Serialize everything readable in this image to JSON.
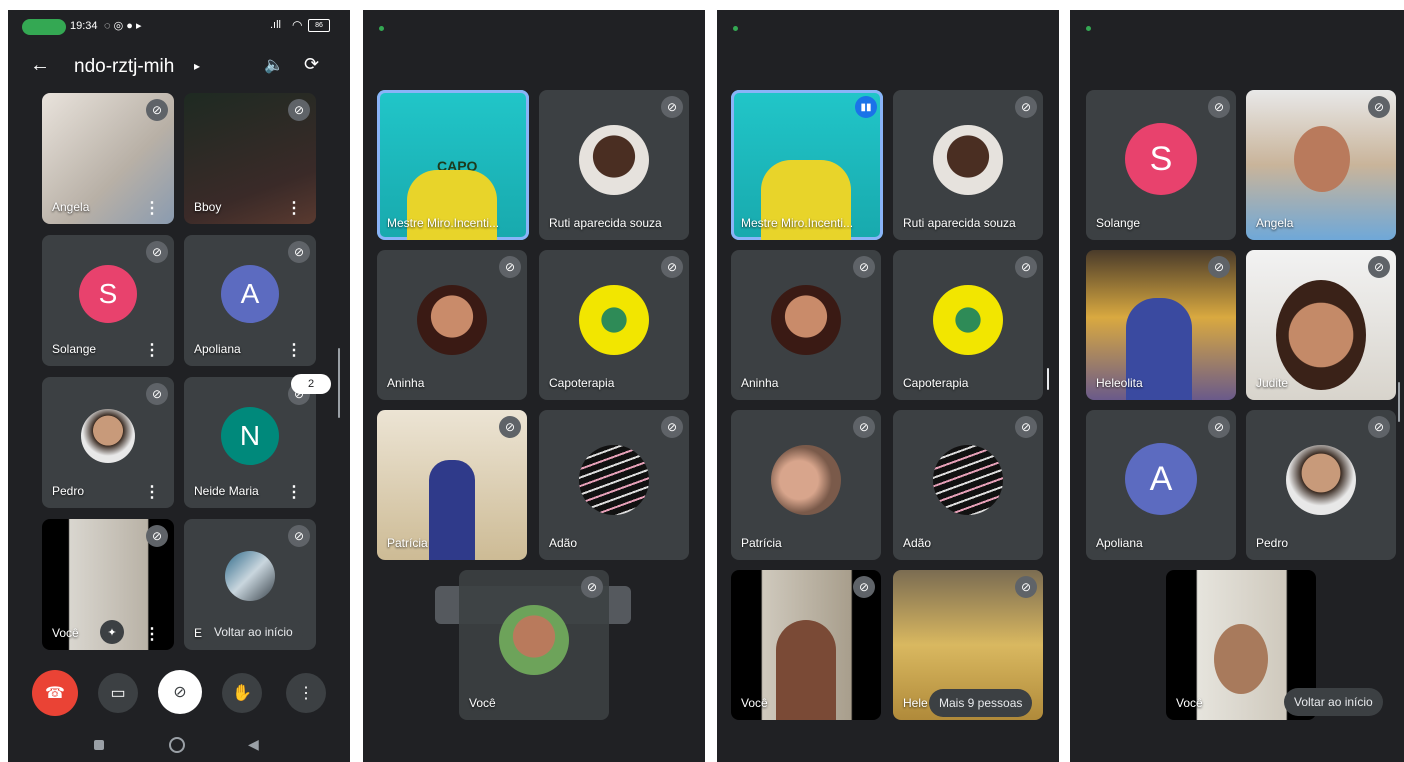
{
  "status_bar": {
    "time": "19:34",
    "signal": ".ıll",
    "battery": "86"
  },
  "call_header": {
    "code": "ndo-rztj-mih",
    "caret": "▸"
  },
  "panel1": {
    "tiles": [
      "Angela",
      "Bboy",
      "Solange",
      "Apoliana",
      "Pedro",
      "Neide Maria",
      "Você",
      "E"
    ],
    "avatar_letters": {
      "solange": "S",
      "apoliana": "A",
      "neide": "N"
    },
    "page_badge": "2",
    "return_button": "Voltar ao início"
  },
  "panel2": {
    "tiles": [
      "Mestre Miro.Incenti...",
      "Ruti aparecida souza",
      "Aninha",
      "Capoterapia",
      "Patrícia",
      "Adão",
      "Você"
    ],
    "banner": "CAPO"
  },
  "panel3": {
    "tiles": [
      "Mestre Miro.Incenti...",
      "Ruti aparecida souza",
      "Aninha",
      "Capoterapia",
      "Patrícia",
      "Adão",
      "Você",
      "Hele"
    ],
    "more_people": "Mais 9 pessoas"
  },
  "panel4": {
    "tiles": [
      "Solange",
      "Angela",
      "Heleolita",
      "Judite",
      "Apoliana",
      "Pedro",
      "Você"
    ],
    "avatar_letters": {
      "solange": "S",
      "apoliana": "A"
    },
    "return_button": "Voltar ao início"
  },
  "colors": {
    "bg": "#202124",
    "tile": "#3c4043",
    "end_call": "#ea4335",
    "solange": "#e8426d",
    "apoliana": "#5c6bc0",
    "neide": "#00897b",
    "active": "#8ab4f8"
  }
}
